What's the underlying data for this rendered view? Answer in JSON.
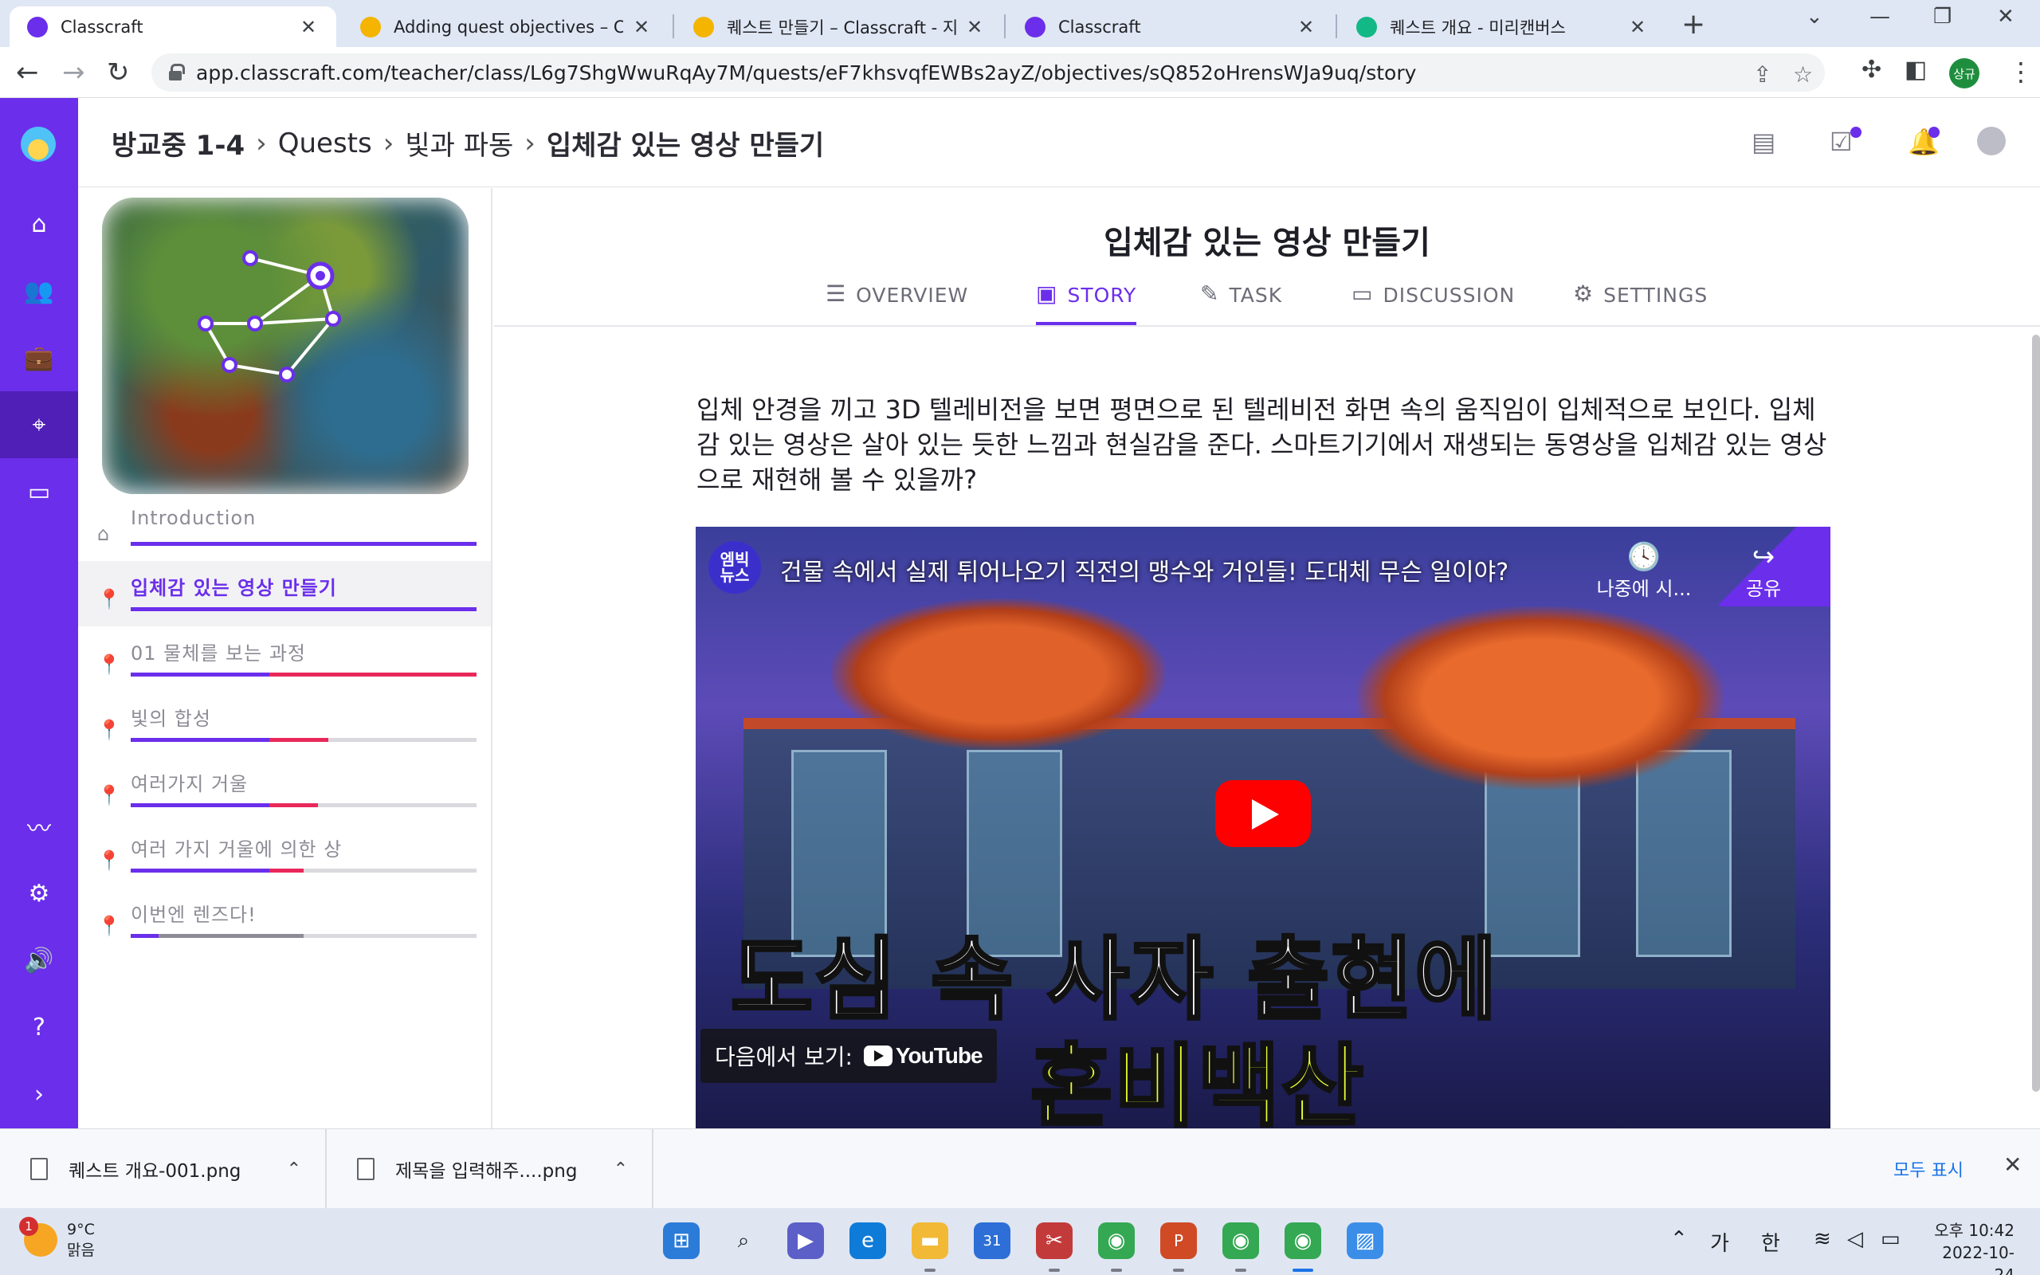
{
  "browser": {
    "tabs": [
      {
        "title": "Classcraft",
        "active": true,
        "favicon_color": "#6b2eeb"
      },
      {
        "title": "Adding quest objectives – Classcraft",
        "active": false,
        "favicon_color": "#f4b400"
      },
      {
        "title": "퀘스트 만들기 – Classcraft - 지식",
        "active": false,
        "favicon_color": "#f4b400"
      },
      {
        "title": "Classcraft",
        "active": false,
        "favicon_color": "#6b2eeb"
      },
      {
        "title": "퀘스트 개요 - 미리캔버스",
        "active": false,
        "favicon_color": "#12b886"
      }
    ],
    "url": "app.classcraft.com/teacher/class/L6g7ShgWwuRqAy7M/quests/eF7khsvqfEWBs2ayZ/objectives/sQ852oHrensWJa9uq/story",
    "profile_initials": "상규"
  },
  "app": {
    "breadcrumb": {
      "class_name": "방교중 1-4",
      "section": "Quests",
      "quest": "빛과 파동",
      "objective": "입체감 있는 영상 만들기"
    },
    "nav_icons": [
      "home-icon",
      "users-icon",
      "briefcase-icon",
      "map-pin-icon",
      "chat-icon",
      "analytics-icon",
      "settings-icon",
      "volume-icon",
      "help-icon",
      "expand-icon"
    ],
    "objectives": [
      {
        "label": "Introduction",
        "active": false,
        "purple": 1.0,
        "red": 0.0,
        "gray": 0.0,
        "icon": "home-icon"
      },
      {
        "label": "입체감 있는 영상 만들기",
        "active": true,
        "purple": 1.0,
        "red": 0.0,
        "gray": 0.0,
        "icon": "pin-icon"
      },
      {
        "label": "01 물체를 보는 과정",
        "active": false,
        "purple": 0.4,
        "red": 0.6,
        "gray": 0.0,
        "icon": "pin-icon"
      },
      {
        "label": "빛의 합성",
        "active": false,
        "purple": 0.4,
        "red": 0.17,
        "gray": 0.0,
        "icon": "pin-icon"
      },
      {
        "label": "여러가지 거울",
        "active": false,
        "purple": 0.4,
        "red": 0.14,
        "gray": 0.0,
        "icon": "pin-icon"
      },
      {
        "label": "여러 가지 거울에 의한 상",
        "active": false,
        "purple": 0.4,
        "red": 0.1,
        "gray": 0.0,
        "icon": "pin-icon"
      },
      {
        "label": "이번엔 렌즈다!",
        "active": false,
        "purple": 0.08,
        "red": 0.0,
        "gray": 0.42,
        "icon": "pin-icon"
      }
    ],
    "quest_title": "입체감 있는 영상 만들기",
    "tabs": [
      {
        "label": "OVERVIEW",
        "icon": "list-check-icon",
        "active": false
      },
      {
        "label": "STORY",
        "icon": "book-icon",
        "active": true
      },
      {
        "label": "TASK",
        "icon": "edit-icon",
        "active": false
      },
      {
        "label": "DISCUSSION",
        "icon": "chat-bubbles-icon",
        "active": false
      },
      {
        "label": "SETTINGS",
        "icon": "gear-icon",
        "active": false
      }
    ],
    "story_text": "입체 안경을 끼고 3D 텔레비전을 보면 평면으로 된 텔레비전 화면 속의 움직임이 입체적으로 보인다. 입체감 있는 영상은 살아 있는 듯한 느낌과 현실감을 준다. 스마트기기에서 재생되는 동영상을 입체감 있는 영상으로 재현해 볼 수 있을까?",
    "video": {
      "channel_badge": "엠빅\n뉴스",
      "title": "건물 속에서 실제 튀어나오기 직전의 맹수와 거인들! 도대체 무슨 일이야?",
      "watch_later": "나중에 시...",
      "share": "공유",
      "caption_line1": "도심 속 사자 출현에",
      "caption_line2": "혼비백산",
      "watch_on": "다음에서 보기:",
      "youtube_label": "YouTube"
    }
  },
  "downloads": {
    "items": [
      "퀘스트 개요-001.png",
      "제목을 입력해주....png"
    ],
    "show_all": "모두 표시"
  },
  "taskbar": {
    "weather_badge": "1",
    "temperature": "9°C",
    "condition": "맑음",
    "ime_1": "가",
    "ime_2": "한",
    "time": "오후 10:42",
    "date": "2022-10-24"
  }
}
